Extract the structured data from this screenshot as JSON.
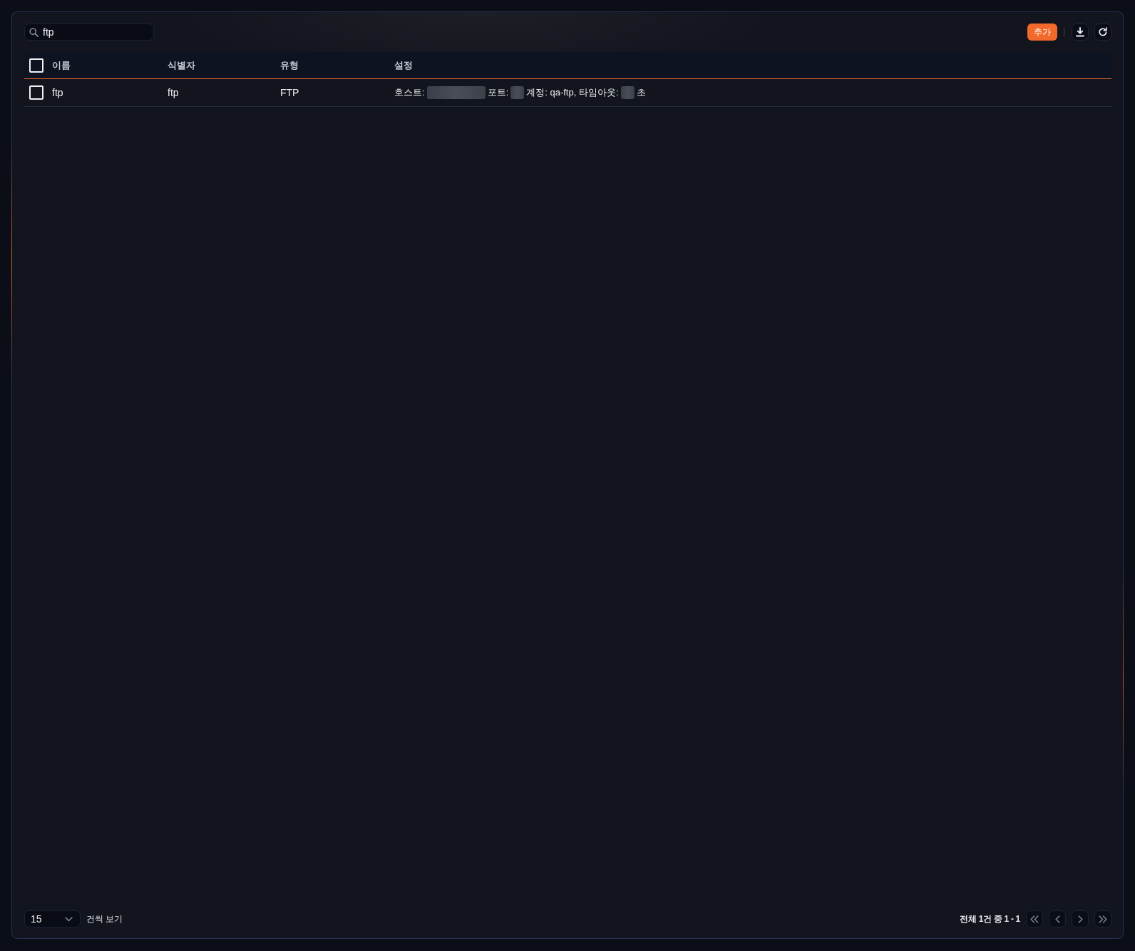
{
  "toolbar": {
    "search": {
      "value": "ftp"
    },
    "add_button": "추가"
  },
  "table": {
    "select_all": {
      "checked": false
    },
    "columns": [
      "이름",
      "식별자",
      "유형",
      "설정"
    ],
    "rows": [
      {
        "checked": false,
        "name": "ftp",
        "identifier": "ftp",
        "type": "FTP",
        "settings": [
          {
            "kind": "text",
            "text": "호스트:"
          },
          {
            "kind": "blur_wide"
          },
          {
            "kind": "text",
            "text": "포트:"
          },
          {
            "kind": "blur_narrow"
          },
          {
            "kind": "text",
            "text": "계정: qa-ftp, 타임아웃:"
          },
          {
            "kind": "blur_narrow"
          },
          {
            "kind": "text",
            "text": "초"
          }
        ]
      }
    ]
  },
  "footer": {
    "page_size": "15",
    "page_size_label": "건씩 보기",
    "range": "전체 1건 중 1 - 1",
    "pager": [
      {
        "kind": "first",
        "disabled": true
      },
      {
        "kind": "previous",
        "disabled": true
      },
      {
        "kind": "next",
        "disabled": true
      },
      {
        "kind": "last",
        "disabled": true
      }
    ]
  }
}
